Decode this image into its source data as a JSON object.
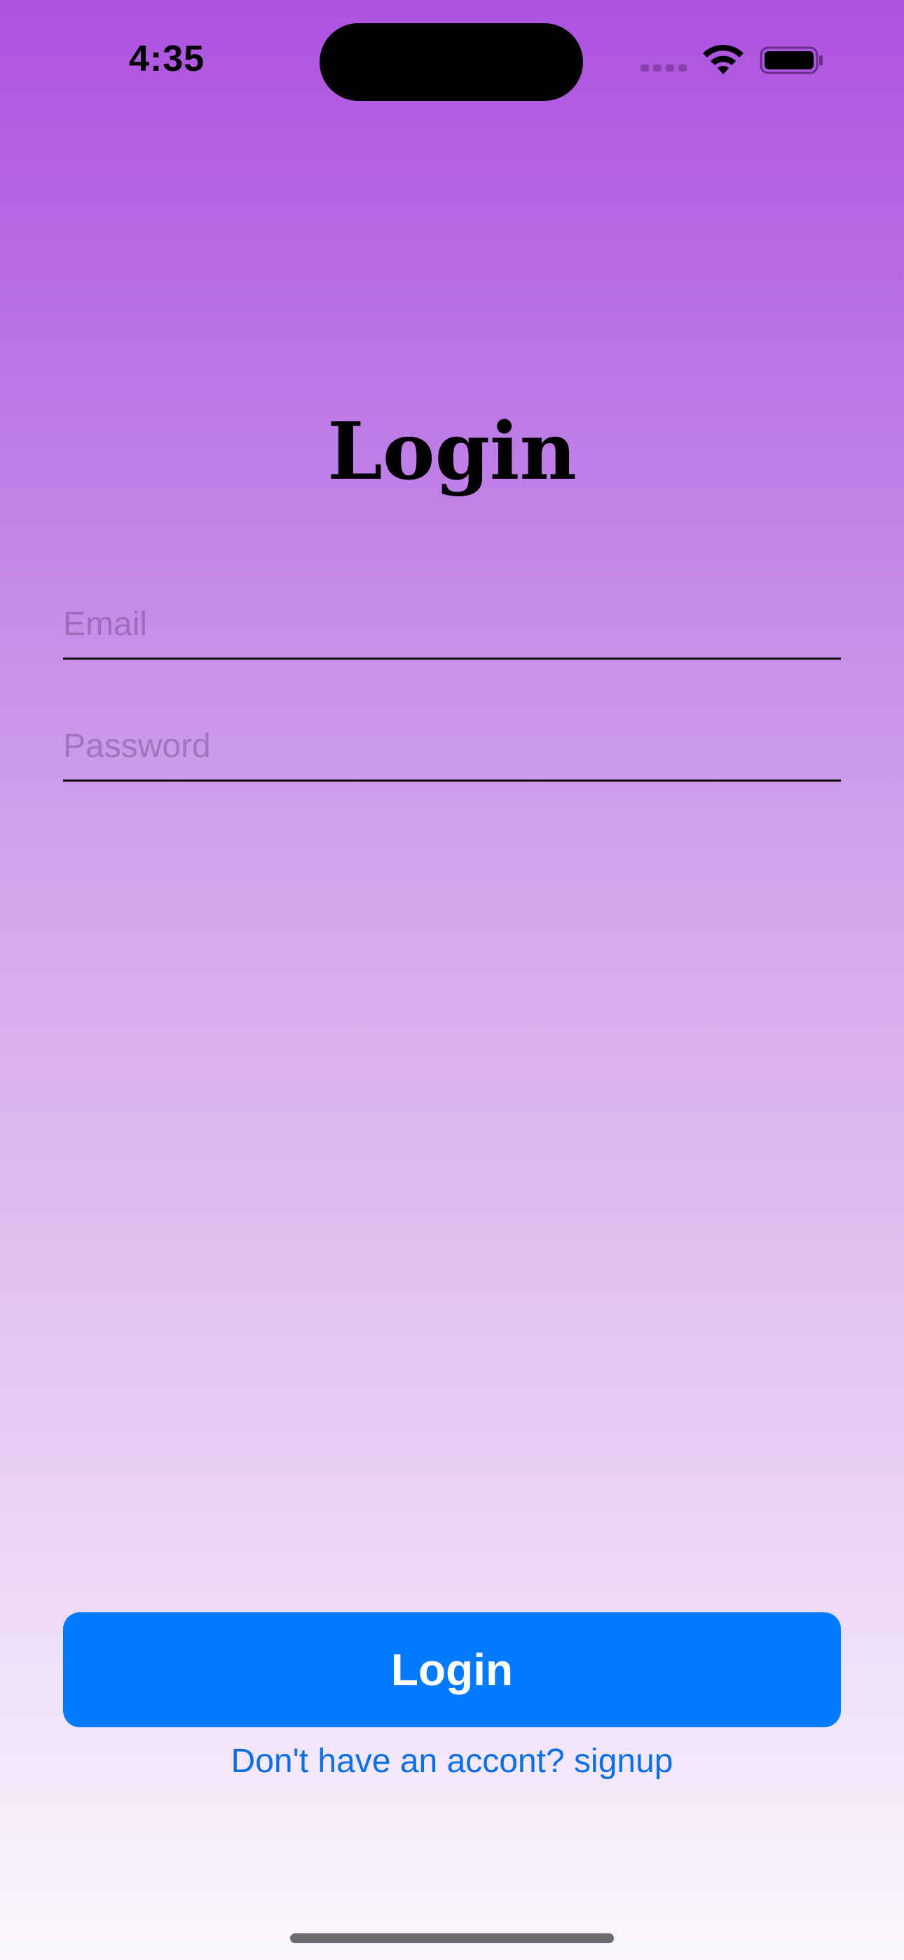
{
  "status_bar": {
    "time": "4:35"
  },
  "main": {
    "title": "Login",
    "email_placeholder": "Email",
    "password_placeholder": "Password",
    "login_button_label": "Login",
    "signup_link_text": "Don't have an accont? signup"
  },
  "colors": {
    "accent": "#007AFF",
    "link": "#0A70E8",
    "gradient_top": "#AD52DF",
    "gradient_bottom": "#FBF7FD"
  },
  "icons": [
    "signal-icon",
    "wifi-icon",
    "battery-icon"
  ]
}
